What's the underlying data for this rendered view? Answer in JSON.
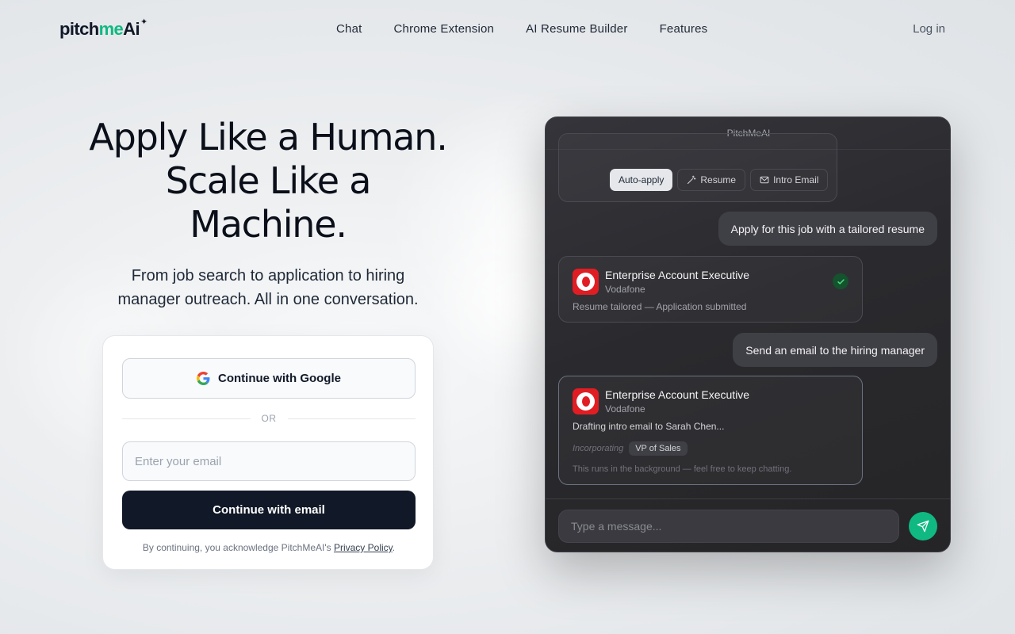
{
  "nav": {
    "logo": {
      "part1": "pitch",
      "part2": "me",
      "part3": "Ai",
      "spark": "✦"
    },
    "links": [
      "Chat",
      "Chrome Extension",
      "AI Resume Builder",
      "Features"
    ],
    "login": "Log in"
  },
  "hero": {
    "title_line1": "Apply Like a Human.",
    "title_line2": "Scale Like a",
    "title_line3": "Machine.",
    "subtitle_line1": "From job search to application to hiring",
    "subtitle_line2": "manager outreach. All in one conversation."
  },
  "auth": {
    "google_label": "Continue with Google",
    "or_label": "OR",
    "email_placeholder": "Enter your email",
    "email_button": "Continue with email",
    "legal_prefix": "By continuing, you acknowledge PitchMeAI's ",
    "legal_link": "Privacy Policy",
    "legal_suffix": "."
  },
  "chat": {
    "header": "PitchMeAI",
    "chips": {
      "auto_apply": "Auto-apply",
      "resume": "Resume",
      "intro_email": "Intro Email"
    },
    "user_msg1": "Apply for this job with a tailored resume",
    "job1": {
      "title": "Enterprise Account Executive",
      "company": "Vodafone",
      "status": "Resume tailored — Application submitted"
    },
    "user_msg2": "Send an email to the hiring manager",
    "job2": {
      "title": "Enterprise Account Executive",
      "company": "Vodafone",
      "drafting": "Drafting intro email to Sarah Chen...",
      "incorporating_label": "Incorporating",
      "incorporating_value": "VP of Sales",
      "note": "This runs in the background — feel free to keep chatting."
    },
    "message_placeholder": "Type a message..."
  },
  "colors": {
    "accent": "#10b981",
    "dark_button": "#111827",
    "vodafone_red": "#e11d24"
  }
}
